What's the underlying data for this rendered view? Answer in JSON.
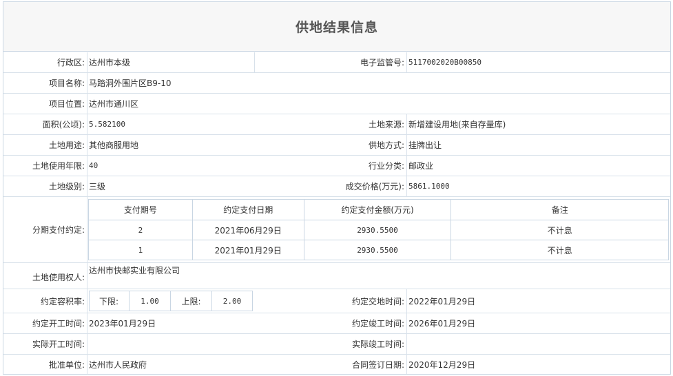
{
  "page_title": "供地结果信息",
  "fields": {
    "district_label": "行政区:",
    "district_value": "达州市本级",
    "supervision_no_label": "电子监管号:",
    "supervision_no_value": "5117002020B00850",
    "project_name_label": "项目名称:",
    "project_name_value": "马踏洞外围片区B9-10",
    "project_location_label": "项目位置:",
    "project_location_value": "达州市通川区",
    "area_label": "面积(公顷):",
    "area_value": "5.582100",
    "land_source_label": "土地来源:",
    "land_source_value": "新增建设用地(来自存量库)",
    "land_use_label": "土地用途:",
    "land_use_value": "其他商服用地",
    "supply_method_label": "供地方式:",
    "supply_method_value": "挂牌出让",
    "land_term_label": "土地使用年限:",
    "land_term_value": "40",
    "industry_label": "行业分类:",
    "industry_value": "邮政业",
    "land_grade_label": "土地级别:",
    "land_grade_value": "三级",
    "price_label": "成交价格(万元):",
    "price_value": "5861.1000",
    "installment_label": "分期支付约定:",
    "land_user_label": "土地使用权人:",
    "land_user_value": "达州市快邮实业有限公司",
    "far_label": "约定容积率:",
    "far_lower_label": "下限:",
    "far_lower_value": "1.00",
    "far_upper_label": "上限:",
    "far_upper_value": "2.00",
    "handover_label": "约定交地时间:",
    "handover_value": "2022年01月29日",
    "planned_start_label": "约定开工时间:",
    "planned_start_value": "2023年01月29日",
    "planned_finish_label": "约定竣工时间:",
    "planned_finish_value": "2026年01月29日",
    "actual_start_label": "实际开工时间:",
    "actual_start_value": "",
    "actual_finish_label": "实际竣工时间:",
    "actual_finish_value": "",
    "approver_label": "批准单位:",
    "approver_value": "达州市人民政府",
    "contract_date_label": "合同签订日期:",
    "contract_date_value": "2020年12月29日"
  },
  "installments": {
    "headers": [
      "支付期号",
      "约定支付日期",
      "约定支付金额(万元)",
      "备注"
    ],
    "rows": [
      [
        "2",
        "2021年06月29日",
        "2930.5500",
        "不计息"
      ],
      [
        "1",
        "2021年01月29日",
        "2930.5500",
        "不计息"
      ]
    ]
  }
}
